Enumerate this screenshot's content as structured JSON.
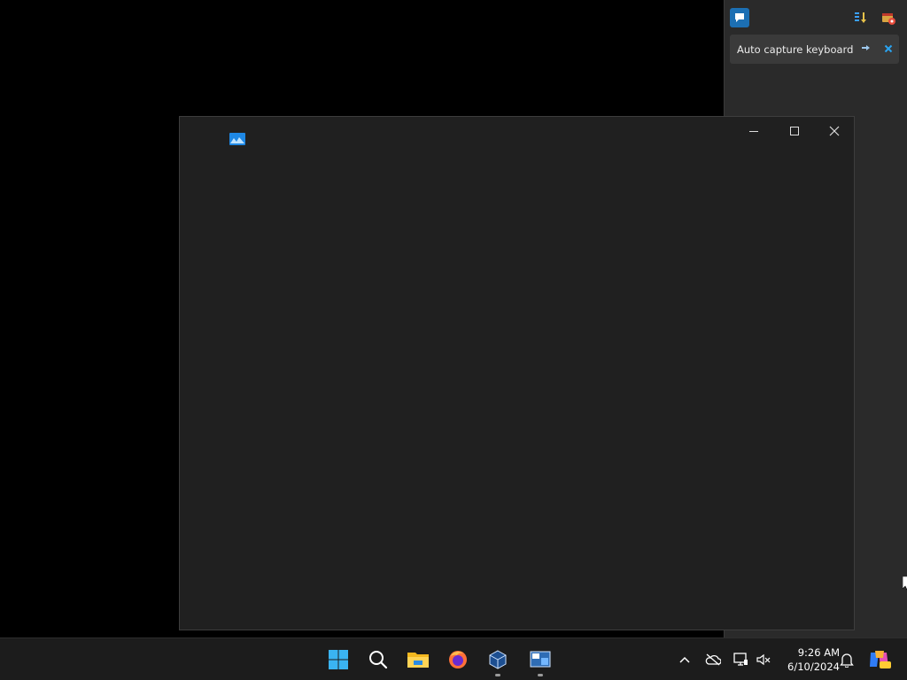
{
  "toast": {
    "text": "Auto capture keyboard ..."
  },
  "clock": {
    "time": "9:26 AM",
    "date": "6/10/2024"
  },
  "window": {
    "minimize_icon": "minimize-icon",
    "maximize_icon": "maximize-icon",
    "close_icon": "close-icon"
  },
  "taskbar": {
    "apps": [
      "start-icon",
      "search-icon",
      "file-explorer-icon",
      "firefox-icon",
      "virtualbox-icon",
      "vm-tool-icon"
    ]
  },
  "tray": {
    "icons": [
      "chevron-up-icon",
      "onedrive-icon",
      "network-icon",
      "volume-muted-icon",
      "notification-bell-icon",
      "copilot-icon"
    ]
  },
  "colors": {
    "desktop": "#000000",
    "window_bg": "#202020",
    "panel_bg": "#2a2a2a",
    "taskbar_bg": "#1c1c1c",
    "accent": "#2aa3f0"
  }
}
